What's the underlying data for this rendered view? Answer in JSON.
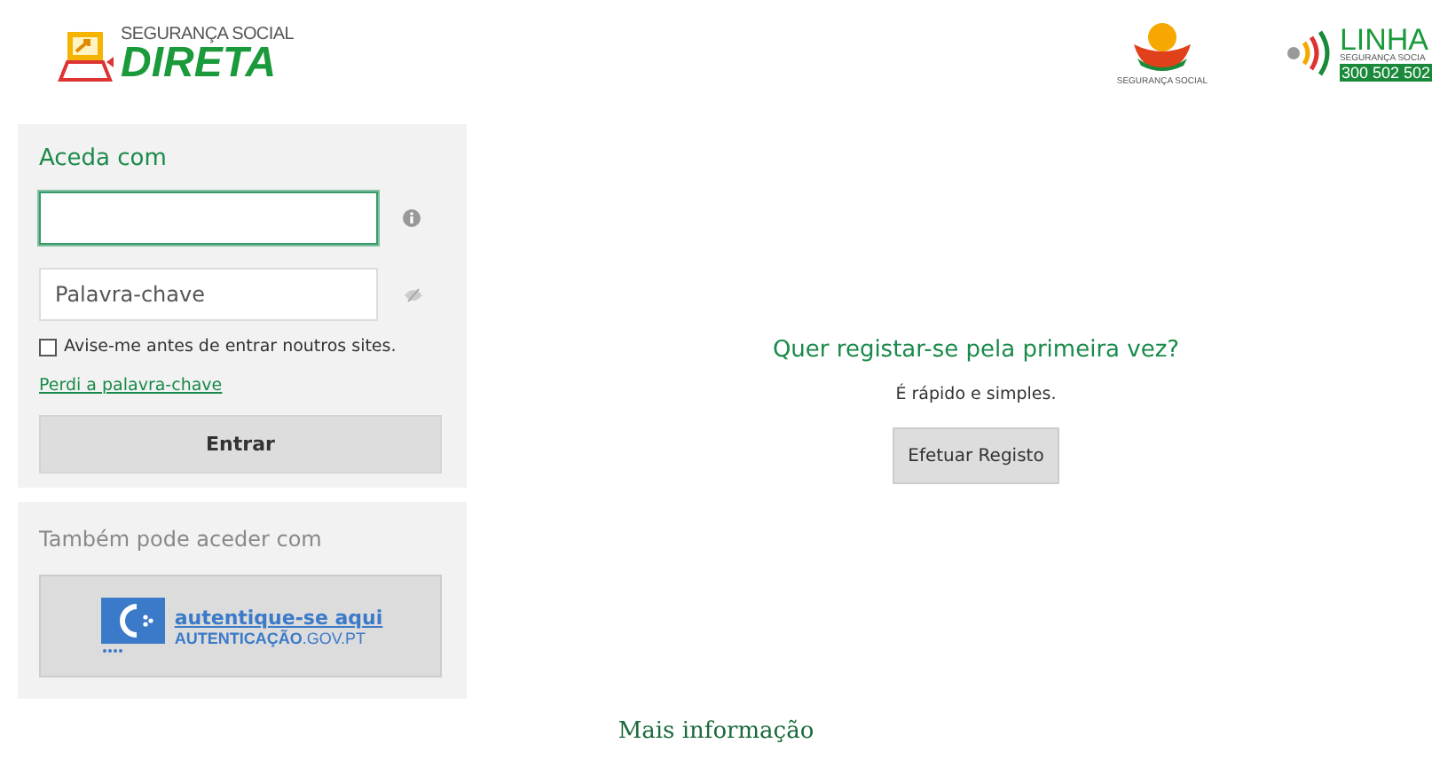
{
  "header": {
    "brand_top": "SEGURANÇA SOCIAL",
    "brand_name": "DIRETA",
    "ss_logo_caption": "SEGURANÇA SOCIAL",
    "hotline": {
      "title": "LINHA",
      "subtitle": "SEGURANÇA SOCIA",
      "number": "300 502 502"
    }
  },
  "login": {
    "title": "Aceda com",
    "fields": [
      {
        "kind": "text",
        "focused": true
      },
      {
        "kind": "password",
        "placeholder": "Palavra-chave",
        "focused": false
      }
    ],
    "remember": {
      "label": "Avise-me antes de entrar noutros sites.",
      "checked": false
    },
    "forgot_link": "Perdi a palavra-chave",
    "submit": "Entrar"
  },
  "alternative": {
    "title": "Também pode aceder com",
    "button_top": "autentique-se aqui",
    "button_bottom_bold": "AUTENTICAÇÃO",
    "button_bottom_rest": ".GOV.PT"
  },
  "register": {
    "title": "Quer registar-se pela primeira vez?",
    "subtitle": "É rápido e simples.",
    "button": "Efetuar Registo"
  },
  "footer_link": "Mais informação"
}
